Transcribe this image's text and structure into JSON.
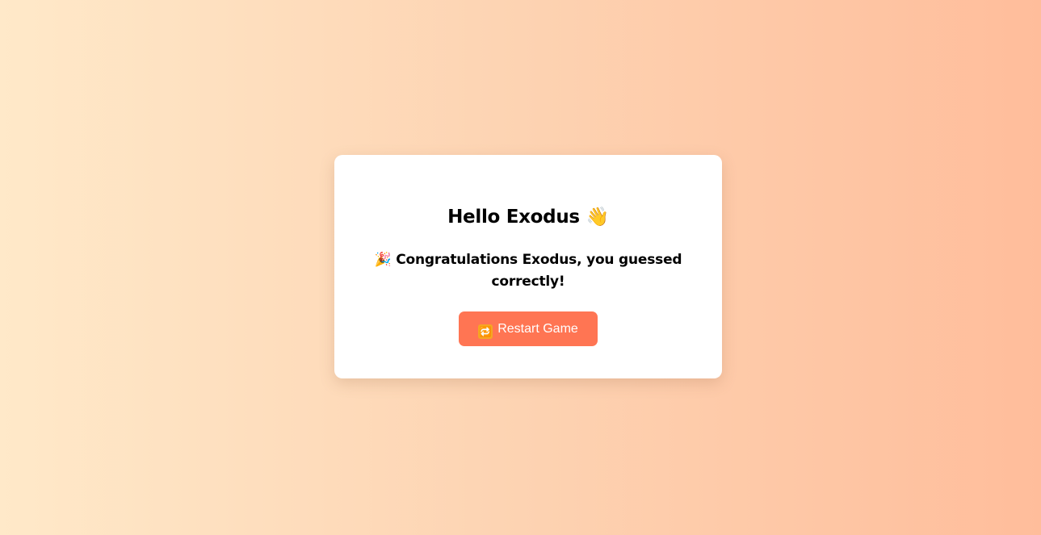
{
  "card": {
    "greeting_text": "Hello Exodus",
    "greeting_emoji": "👋",
    "message_emoji": "🎉",
    "message_text": "Congratulations Exodus, you guessed correctly!",
    "restart_button": {
      "icon": "🔁",
      "label": "Restart Game"
    }
  },
  "colors": {
    "button_bg": "#ff7553",
    "background_start": "#ffe9c9",
    "background_end": "#ffbd9b"
  },
  "icons": {
    "greeting": "waving-hand-icon",
    "message": "party-popper-icon",
    "button": "repeat-icon"
  }
}
